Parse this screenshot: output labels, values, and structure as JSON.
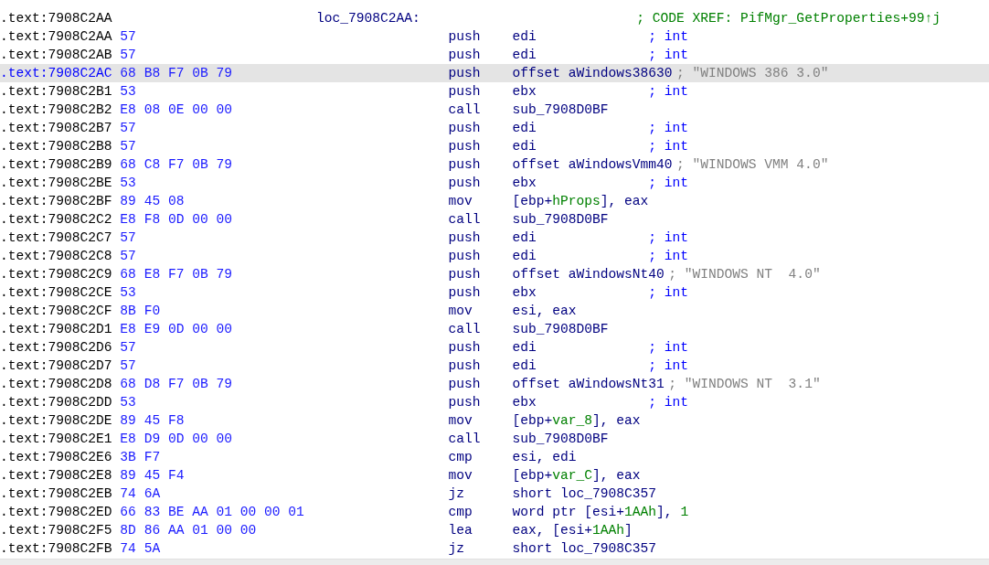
{
  "listing": {
    "lines": [
      {
        "address": ".text:7908C2AA",
        "label": "loc_7908C2AA:",
        "comment": {
          "text": "; CODE XREF: PifMgr_GetProperties+99↑j",
          "kind": "xref"
        },
        "selected": false
      },
      {
        "address": ".text:7908C2AA",
        "bytes": "57",
        "mnemonic": "push",
        "operands": [
          {
            "text": "edi",
            "kind": "reg"
          }
        ],
        "comment": {
          "text": "; int",
          "kind": "type"
        },
        "selected": false
      },
      {
        "address": ".text:7908C2AB",
        "bytes": "57",
        "mnemonic": "push",
        "operands": [
          {
            "text": "edi",
            "kind": "reg"
          }
        ],
        "comment": {
          "text": "; int",
          "kind": "type"
        },
        "selected": false
      },
      {
        "address": ".text:7908C2AC",
        "bytes": "68 B8 F7 0B 79",
        "mnemonic": "push",
        "operands": [
          {
            "text": "offset aWindows38630",
            "kind": "reg"
          }
        ],
        "comment": {
          "text": "; \"WINDOWS 386 3.0\"",
          "kind": "string"
        },
        "selected": true
      },
      {
        "address": ".text:7908C2B1",
        "bytes": "53",
        "mnemonic": "push",
        "operands": [
          {
            "text": "ebx",
            "kind": "reg"
          }
        ],
        "comment": {
          "text": "; int",
          "kind": "type"
        },
        "selected": false
      },
      {
        "address": ".text:7908C2B2",
        "bytes": "E8 08 0E 00 00",
        "mnemonic": "call",
        "operands": [
          {
            "text": "sub_7908D0BF",
            "kind": "reg"
          }
        ],
        "selected": false
      },
      {
        "address": ".text:7908C2B7",
        "bytes": "57",
        "mnemonic": "push",
        "operands": [
          {
            "text": "edi",
            "kind": "reg"
          }
        ],
        "comment": {
          "text": "; int",
          "kind": "type"
        },
        "selected": false
      },
      {
        "address": ".text:7908C2B8",
        "bytes": "57",
        "mnemonic": "push",
        "operands": [
          {
            "text": "edi",
            "kind": "reg"
          }
        ],
        "comment": {
          "text": "; int",
          "kind": "type"
        },
        "selected": false
      },
      {
        "address": ".text:7908C2B9",
        "bytes": "68 C8 F7 0B 79",
        "mnemonic": "push",
        "operands": [
          {
            "text": "offset aWindowsVmm40",
            "kind": "reg"
          }
        ],
        "comment": {
          "text": "; \"WINDOWS VMM 4.0\"",
          "kind": "string"
        },
        "selected": false
      },
      {
        "address": ".text:7908C2BE",
        "bytes": "53",
        "mnemonic": "push",
        "operands": [
          {
            "text": "ebx",
            "kind": "reg"
          }
        ],
        "comment": {
          "text": "; int",
          "kind": "type"
        },
        "selected": false
      },
      {
        "address": ".text:7908C2BF",
        "bytes": "89 45 08",
        "mnemonic": "mov",
        "operands": [
          {
            "text": "[ebp+",
            "kind": "reg"
          },
          {
            "text": "hProps",
            "kind": "var"
          },
          {
            "text": "], eax",
            "kind": "reg"
          }
        ],
        "selected": false
      },
      {
        "address": ".text:7908C2C2",
        "bytes": "E8 F8 0D 00 00",
        "mnemonic": "call",
        "operands": [
          {
            "text": "sub_7908D0BF",
            "kind": "reg"
          }
        ],
        "selected": false
      },
      {
        "address": ".text:7908C2C7",
        "bytes": "57",
        "mnemonic": "push",
        "operands": [
          {
            "text": "edi",
            "kind": "reg"
          }
        ],
        "comment": {
          "text": "; int",
          "kind": "type"
        },
        "selected": false
      },
      {
        "address": ".text:7908C2C8",
        "bytes": "57",
        "mnemonic": "push",
        "operands": [
          {
            "text": "edi",
            "kind": "reg"
          }
        ],
        "comment": {
          "text": "; int",
          "kind": "type"
        },
        "selected": false
      },
      {
        "address": ".text:7908C2C9",
        "bytes": "68 E8 F7 0B 79",
        "mnemonic": "push",
        "operands": [
          {
            "text": "offset aWindowsNt40",
            "kind": "reg"
          }
        ],
        "comment": {
          "text": "; \"WINDOWS NT  4.0\"",
          "kind": "string"
        },
        "selected": false
      },
      {
        "address": ".text:7908C2CE",
        "bytes": "53",
        "mnemonic": "push",
        "operands": [
          {
            "text": "ebx",
            "kind": "reg"
          }
        ],
        "comment": {
          "text": "; int",
          "kind": "type"
        },
        "selected": false
      },
      {
        "address": ".text:7908C2CF",
        "bytes": "8B F0",
        "mnemonic": "mov",
        "operands": [
          {
            "text": "esi, eax",
            "kind": "reg"
          }
        ],
        "selected": false
      },
      {
        "address": ".text:7908C2D1",
        "bytes": "E8 E9 0D 00 00",
        "mnemonic": "call",
        "operands": [
          {
            "text": "sub_7908D0BF",
            "kind": "reg"
          }
        ],
        "selected": false
      },
      {
        "address": ".text:7908C2D6",
        "bytes": "57",
        "mnemonic": "push",
        "operands": [
          {
            "text": "edi",
            "kind": "reg"
          }
        ],
        "comment": {
          "text": "; int",
          "kind": "type"
        },
        "selected": false
      },
      {
        "address": ".text:7908C2D7",
        "bytes": "57",
        "mnemonic": "push",
        "operands": [
          {
            "text": "edi",
            "kind": "reg"
          }
        ],
        "comment": {
          "text": "; int",
          "kind": "type"
        },
        "selected": false
      },
      {
        "address": ".text:7908C2D8",
        "bytes": "68 D8 F7 0B 79",
        "mnemonic": "push",
        "operands": [
          {
            "text": "offset aWindowsNt31",
            "kind": "reg"
          }
        ],
        "comment": {
          "text": "; \"WINDOWS NT  3.1\"",
          "kind": "string"
        },
        "selected": false
      },
      {
        "address": ".text:7908C2DD",
        "bytes": "53",
        "mnemonic": "push",
        "operands": [
          {
            "text": "ebx",
            "kind": "reg"
          }
        ],
        "comment": {
          "text": "; int",
          "kind": "type"
        },
        "selected": false
      },
      {
        "address": ".text:7908C2DE",
        "bytes": "89 45 F8",
        "mnemonic": "mov",
        "operands": [
          {
            "text": "[ebp+",
            "kind": "reg"
          },
          {
            "text": "var_8",
            "kind": "var"
          },
          {
            "text": "], eax",
            "kind": "reg"
          }
        ],
        "selected": false
      },
      {
        "address": ".text:7908C2E1",
        "bytes": "E8 D9 0D 00 00",
        "mnemonic": "call",
        "operands": [
          {
            "text": "sub_7908D0BF",
            "kind": "reg"
          }
        ],
        "selected": false
      },
      {
        "address": ".text:7908C2E6",
        "bytes": "3B F7",
        "mnemonic": "cmp",
        "operands": [
          {
            "text": "esi, edi",
            "kind": "reg"
          }
        ],
        "selected": false
      },
      {
        "address": ".text:7908C2E8",
        "bytes": "89 45 F4",
        "mnemonic": "mov",
        "operands": [
          {
            "text": "[ebp+",
            "kind": "reg"
          },
          {
            "text": "var_C",
            "kind": "var"
          },
          {
            "text": "], eax",
            "kind": "reg"
          }
        ],
        "selected": false
      },
      {
        "address": ".text:7908C2EB",
        "bytes": "74 6A",
        "mnemonic": "jz",
        "operands": [
          {
            "text": "short loc_7908C357",
            "kind": "reg"
          }
        ],
        "selected": false
      },
      {
        "address": ".text:7908C2ED",
        "bytes": "66 83 BE AA 01 00 00 01",
        "mnemonic": "cmp",
        "operands": [
          {
            "text": "word ptr [esi+",
            "kind": "reg"
          },
          {
            "text": "1AAh",
            "kind": "var"
          },
          {
            "text": "], ",
            "kind": "reg"
          },
          {
            "text": "1",
            "kind": "var"
          }
        ],
        "selected": false
      },
      {
        "address": ".text:7908C2F5",
        "bytes": "8D 86 AA 01 00 00",
        "mnemonic": "lea",
        "operands": [
          {
            "text": "eax, [esi+",
            "kind": "reg"
          },
          {
            "text": "1AAh",
            "kind": "var"
          },
          {
            "text": "]",
            "kind": "reg"
          }
        ],
        "selected": false
      },
      {
        "address": ".text:7908C2FB",
        "bytes": "74 5A",
        "mnemonic": "jz",
        "operands": [
          {
            "text": "short loc_7908C357",
            "kind": "reg"
          }
        ],
        "selected": false
      }
    ]
  }
}
